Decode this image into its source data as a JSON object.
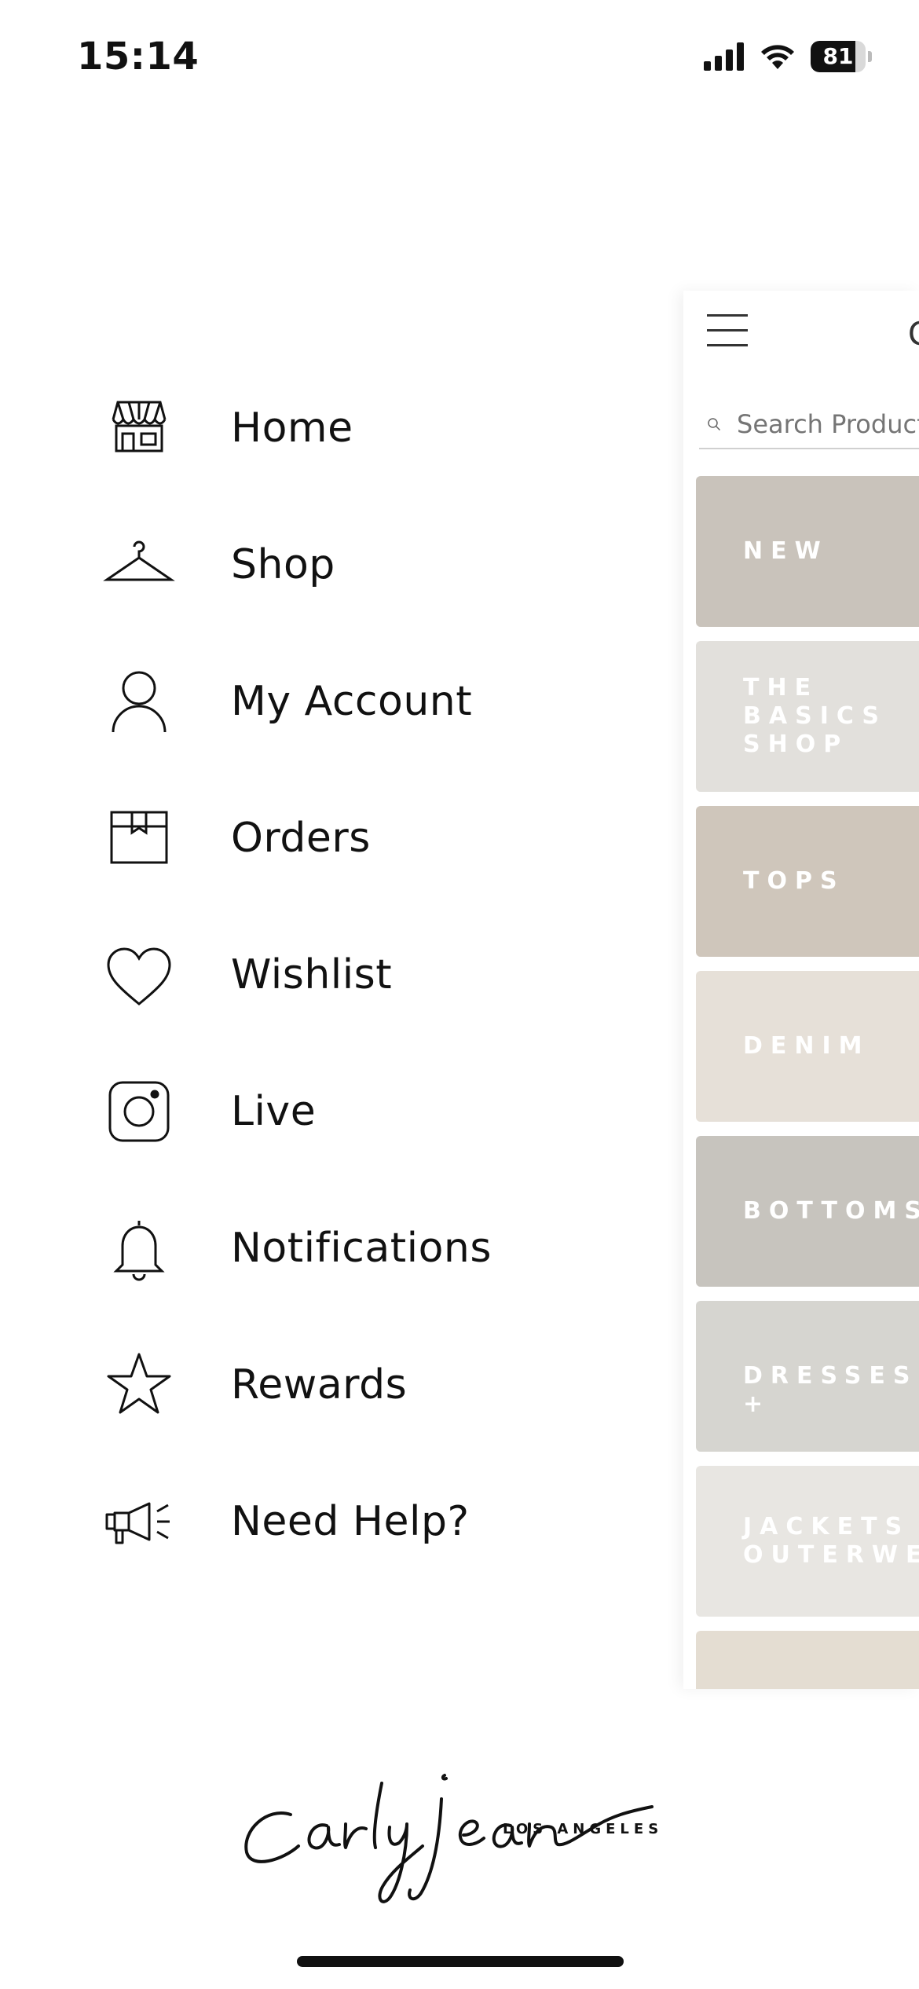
{
  "status_bar": {
    "time": "15:14",
    "battery_percent": 81,
    "battery_label": "81",
    "icons": [
      "signal-icon",
      "wifi-icon",
      "battery-icon"
    ]
  },
  "menu": {
    "items": [
      {
        "label": "Home",
        "icon": "storefront-icon"
      },
      {
        "label": "Shop",
        "icon": "hanger-icon"
      },
      {
        "label": "My Account",
        "icon": "user-icon"
      },
      {
        "label": "Orders",
        "icon": "box-icon"
      },
      {
        "label": "Wishlist",
        "icon": "heart-icon"
      },
      {
        "label": "Live",
        "icon": "instagram-icon"
      },
      {
        "label": "Notifications",
        "icon": "bell-icon"
      },
      {
        "label": "Rewards",
        "icon": "star-icon"
      },
      {
        "label": "Need Help?",
        "icon": "megaphone-icon"
      }
    ]
  },
  "main": {
    "header_letter": "C",
    "search_placeholder": "Search Products",
    "categories": [
      {
        "label": "NEW",
        "color": "#c9c3bb"
      },
      {
        "label": "THE\nBASICS\nSHOP",
        "color": "#e2e0dc"
      },
      {
        "label": "TOPS",
        "color": "#cfc6bb"
      },
      {
        "label": "DENIM",
        "color": "#e6e0d8"
      },
      {
        "label": "BOTTOMS",
        "color": "#c7c4be"
      },
      {
        "label": "DRESSES +",
        "color": "#d6d5d0"
      },
      {
        "label": "JACKETS +\nOUTERWEA",
        "color": "#e8e6e2"
      },
      {
        "label": "",
        "color": "#e4ddd2"
      }
    ]
  },
  "brand": {
    "logo_script": "carlyjean",
    "logo_sub": "LOS ANGELES"
  }
}
